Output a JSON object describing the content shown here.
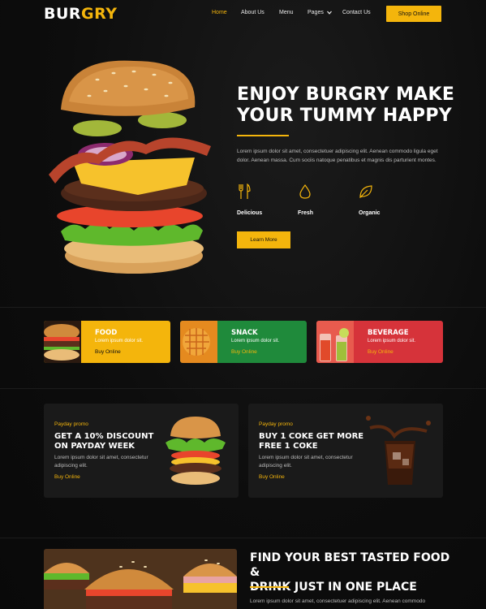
{
  "brand": {
    "part1": "BUR",
    "part2": "GRY"
  },
  "nav": {
    "items": [
      "Home",
      "About Us",
      "Menu",
      "Pages",
      "Contact Us"
    ],
    "active": "Home",
    "cta": "Shop Online"
  },
  "hero": {
    "title_line1": "ENJOY BURGRY MAKE",
    "title_line2": "YOUR TUMMY HAPPY",
    "description": "Lorem ipsum dolor sit amet, consectetuer adipiscing elit. Aenean commodo ligula eget dolor. Aenean massa. Cum sociis natoque penatibus et magnis dis parturient montes.",
    "features": [
      {
        "label": "Delicious",
        "icon": "cutlery-icon"
      },
      {
        "label": "Fresh",
        "icon": "water-drop-icon"
      },
      {
        "label": "Organic",
        "icon": "leaf-icon"
      }
    ],
    "cta": "Learn More"
  },
  "categories": [
    {
      "title": "FOOD",
      "desc": "Lorem ipsum dolor sit.",
      "link": "Buy Online",
      "bg": "#f4b50c",
      "link_color": "#111111"
    },
    {
      "title": "SNACK",
      "desc": "Lorem ipsum dolor sit.",
      "link": "Buy Online",
      "bg": "#1f8a3b",
      "link_color": "#f4b50c"
    },
    {
      "title": "BEVERAGE",
      "desc": "Lorem ipsum dolor sit.",
      "link": "Buy Online",
      "bg": "#d6333a",
      "link_color": "#f4b50c"
    }
  ],
  "promos": [
    {
      "tag": "Payday promo",
      "title": "GET A 10% DISCOUNT ON PAYDAY WEEK",
      "desc": "Lorem ipsum dolor sit amet, consectetur adipiscing elit.",
      "link": "Buy Online"
    },
    {
      "tag": "Payday promo",
      "title": "BUY 1 COKE GET MORE FREE 1 COKE",
      "desc": "Lorem ipsum dolor sit amet, consectetur adipiscing elit.",
      "link": "Buy Online"
    }
  ],
  "bottom": {
    "title_line1": "FIND YOUR BEST TASTED FOOD &",
    "title_line2": "DRINK JUST IN ONE PLACE",
    "desc": "Lorem ipsum dolor sit amet, consectetuer adipiscing elit. Aenean commodo"
  },
  "colors": {
    "accent": "#f4b50c",
    "background": "#0c0c0c",
    "card": "#1a1a1a"
  }
}
